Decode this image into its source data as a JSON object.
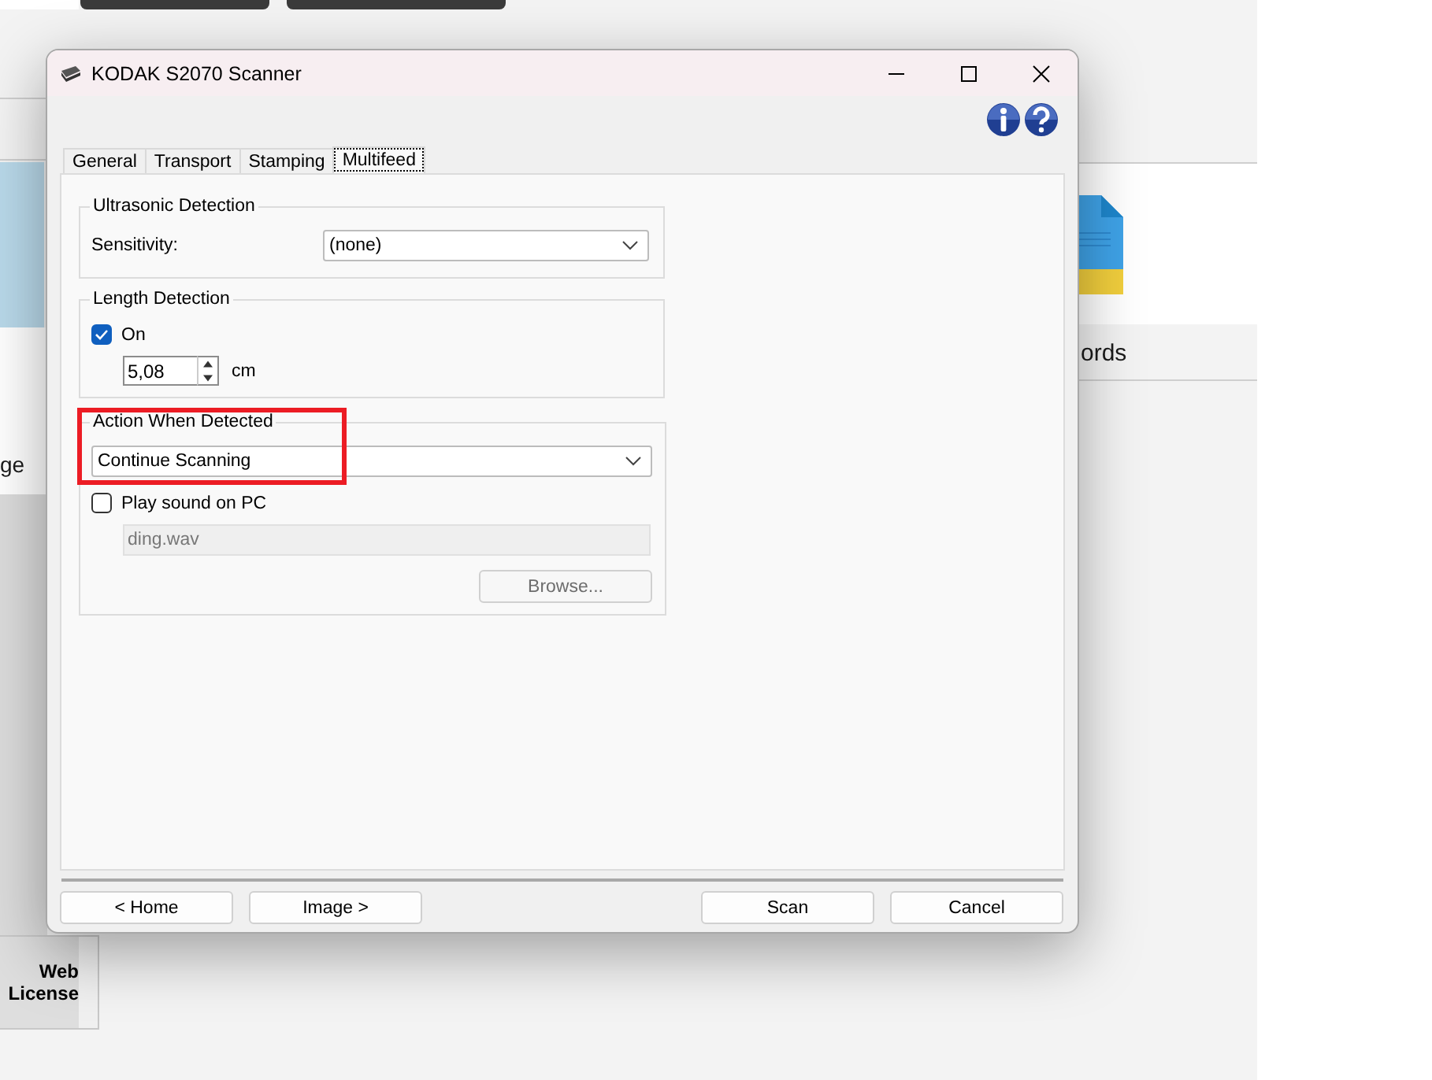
{
  "background_app": {
    "left_fragment": "ge",
    "right_fragment": "ords",
    "tile_label": "Web License"
  },
  "window": {
    "title": "KODAK S2070 Scanner"
  },
  "tabs": [
    {
      "label": "General",
      "selected": false
    },
    {
      "label": "Transport",
      "selected": false
    },
    {
      "label": "Stamping",
      "selected": false
    },
    {
      "label": "Multifeed",
      "selected": true
    }
  ],
  "ultrasonic_detection": {
    "title": "Ultrasonic Detection",
    "sensitivity_label": "Sensitivity:",
    "sensitivity_value": "(none)"
  },
  "length_detection": {
    "title": "Length Detection",
    "on_label": "On",
    "on_checked": true,
    "length_value": "5,08",
    "unit": "cm"
  },
  "action_when_detected": {
    "title": "Action When Detected",
    "value": "Continue Scanning",
    "highlighted": true,
    "play_sound_label": "Play sound on PC",
    "play_sound_checked": false,
    "sound_file": "ding.wav",
    "sound_file_disabled": true,
    "browse_button": "Browse..."
  },
  "footer_buttons": [
    "< Home",
    "Image >",
    "Scan",
    "Cancel"
  ]
}
